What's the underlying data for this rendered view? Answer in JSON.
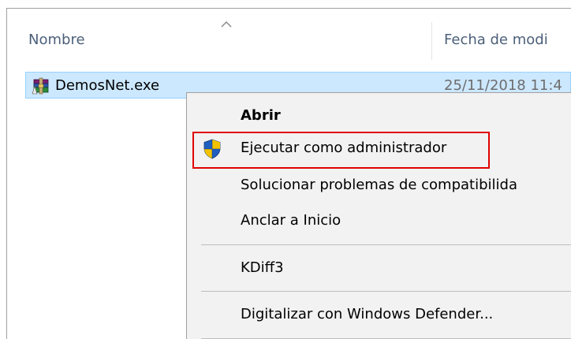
{
  "explorer": {
    "columns": {
      "name": "Nombre",
      "date": "Fecha de modi"
    },
    "file": {
      "name": "DemosNet.exe",
      "date": "25/11/2018 11:4",
      "icon": "winrar-archive-icon"
    }
  },
  "context_menu": {
    "items": [
      {
        "label": "Abrir",
        "bold": true
      },
      {
        "label": "Ejecutar como administrador",
        "icon": "uac-shield-icon",
        "highlighted": true
      },
      {
        "label": "Solucionar problemas de compatibilida"
      },
      {
        "label": "Anclar a Inicio"
      },
      {
        "label": "KDiff3"
      },
      {
        "label": "Digitalizar con Windows Defender..."
      }
    ]
  },
  "colors": {
    "selection_fill": "#cce8ff",
    "selection_border": "#99d1ff",
    "header_text": "#4c607a",
    "menu_background": "#f2f2f2",
    "highlight_outline": "#e00000"
  }
}
